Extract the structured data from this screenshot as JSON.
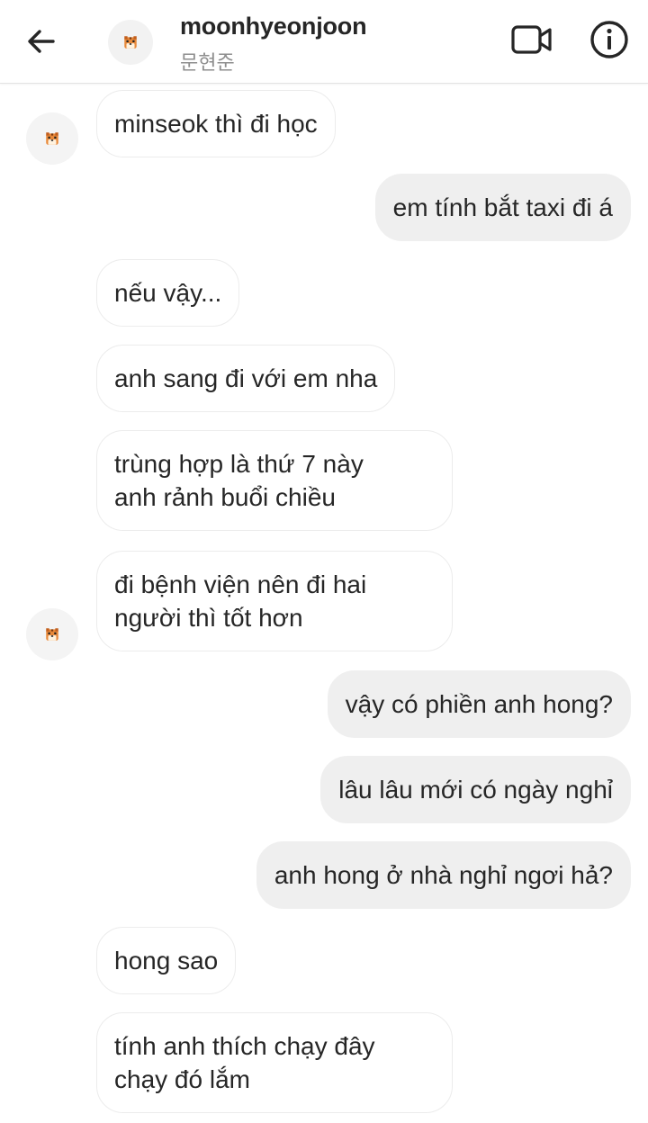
{
  "header": {
    "username": "moonhyeonjoon",
    "subtitle": "문현준",
    "icons": [
      "back-arrow-icon",
      "tiger-avatar-icon",
      "video-call-icon",
      "info-icon"
    ]
  },
  "messages": [
    {
      "from": "them",
      "text": "minseok thì đi học"
    },
    {
      "from": "me",
      "text": "em tính bắt taxi đi á"
    },
    {
      "from": "them",
      "text": "nếu vậy..."
    },
    {
      "from": "them",
      "text": "anh sang đi với em nha"
    },
    {
      "from": "them",
      "line1": "trùng hợp là thứ 7 này",
      "line2": "anh rảnh buổi chiều"
    },
    {
      "from": "them",
      "line1": "đi bệnh viện nên đi hai",
      "line2": "người thì tốt hơn"
    },
    {
      "from": "me",
      "text": "vậy có phiền anh hong?"
    },
    {
      "from": "me",
      "text": "lâu lâu mới có ngày nghỉ"
    },
    {
      "from": "me",
      "text": "anh hong ở nhà nghỉ ngơi hả?"
    },
    {
      "from": "them",
      "text": "hong sao"
    },
    {
      "from": "them",
      "line1": "tính anh thích chạy đây",
      "line2": "chạy đó lắm"
    }
  ],
  "colors": {
    "incoming_bg": "#ffffff",
    "incoming_border": "#ececec",
    "outgoing_bg": "#efefef",
    "text": "#262626",
    "muted": "#8e8e8e"
  }
}
